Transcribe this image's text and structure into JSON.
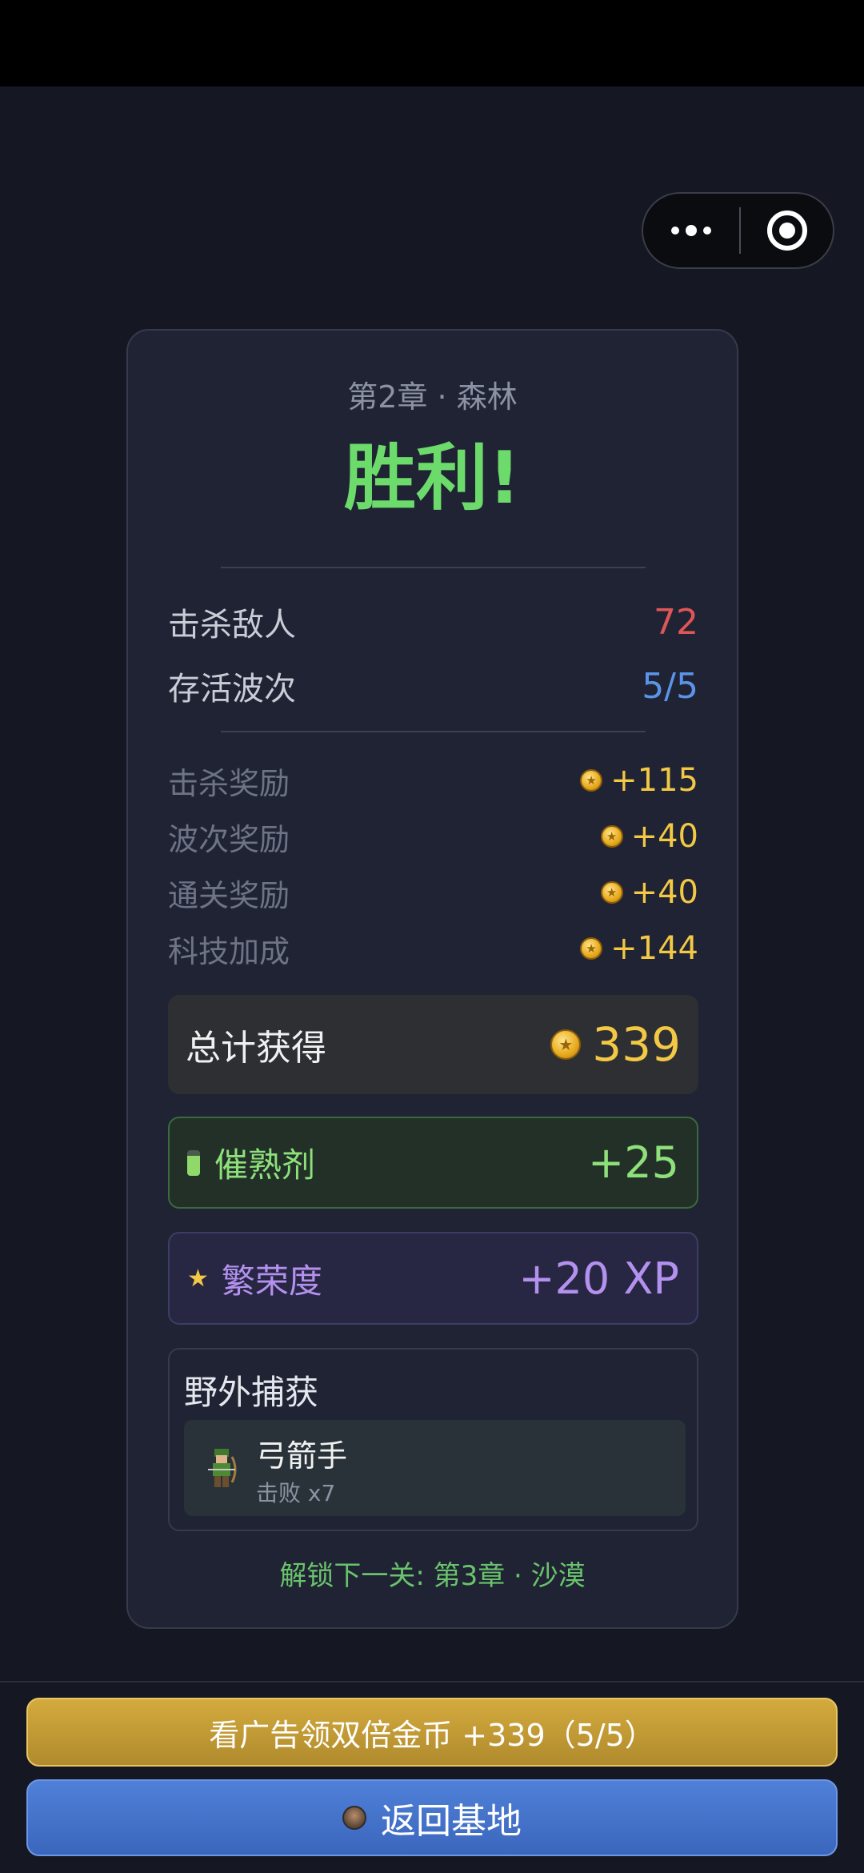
{
  "header": {
    "chapter": "第2章 · 森林",
    "result": "胜利!"
  },
  "stats": [
    {
      "label": "击杀敌人",
      "value": "72",
      "color": "#e05555"
    },
    {
      "label": "存活波次",
      "value": "5/5",
      "color": "#5b93e8"
    }
  ],
  "rewards": [
    {
      "label": "击杀奖励",
      "amount": "+115"
    },
    {
      "label": "波次奖励",
      "amount": "+40"
    },
    {
      "label": "通关奖励",
      "amount": "+40"
    },
    {
      "label": "科技加成",
      "amount": "+144"
    }
  ],
  "total": {
    "label": "总计获得",
    "value": "339"
  },
  "catalyst": {
    "label": "催熟剂",
    "value": "+25"
  },
  "prosperity": {
    "label": "繁荣度",
    "value": "+20 XP"
  },
  "capture": {
    "title": "野外捕获",
    "unit_name": "弓箭手",
    "unit_detail": "击败 x7"
  },
  "unlock_text": "解锁下一关: 第3章 · 沙漠",
  "buttons": {
    "ad_double": "看广告领双倍金币 +339（5/5）",
    "return_base": "返回基地"
  },
  "colors": {
    "victory": "#6cdb6c",
    "gold": "#f2c845",
    "purple": "#b491ee",
    "green": "#8ee07a"
  },
  "icons": {
    "capsule": [
      "more-icon",
      "close-target-icon"
    ],
    "reward": "coin-icon",
    "catalyst": "potion-bottle-icon",
    "prosperity": "star-icon",
    "capture": "archer-sprite-icon",
    "return": "base-icon"
  }
}
